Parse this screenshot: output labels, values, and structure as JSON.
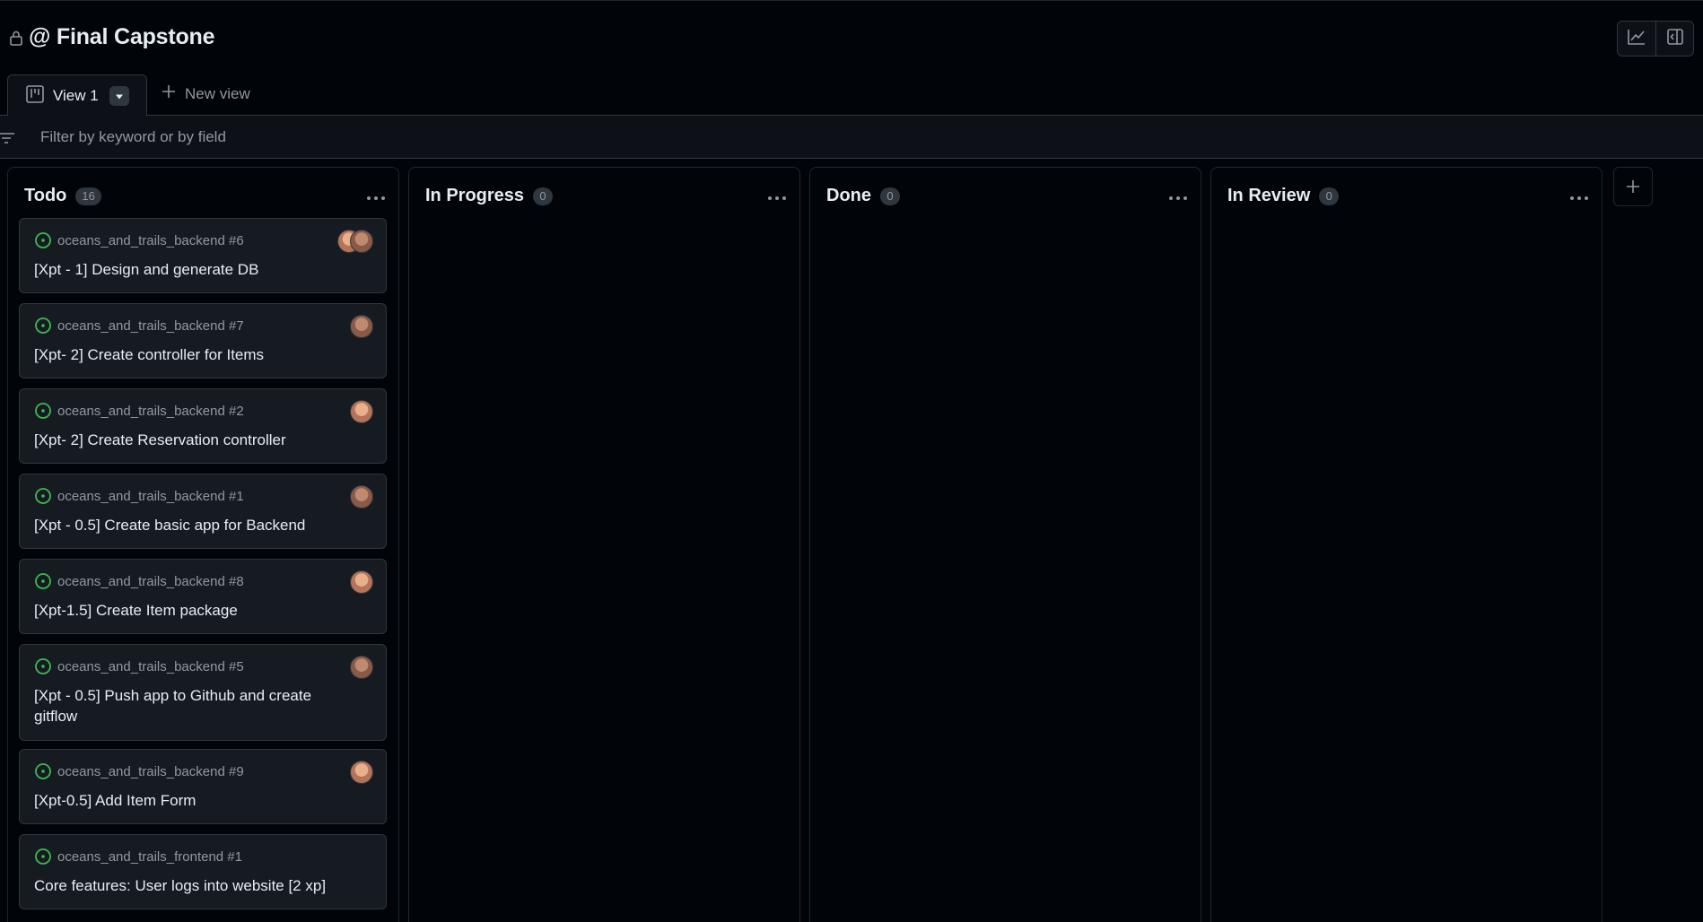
{
  "project": {
    "title": "@ Final Capstone"
  },
  "tabs": {
    "active": {
      "label": "View 1"
    },
    "new_view_label": "New view"
  },
  "filter": {
    "placeholder": "Filter by keyword or by field"
  },
  "columns": [
    {
      "title": "Todo",
      "count": "16",
      "cards": [
        {
          "repo": "oceans_and_trails_backend #6",
          "title": "[Xpt - 1] Design and generate DB",
          "avatars": 2
        },
        {
          "repo": "oceans_and_trails_backend #7",
          "title": "[Xpt- 2] Create controller for Items",
          "avatars": 1
        },
        {
          "repo": "oceans_and_trails_backend #2",
          "title": "[Xpt- 2] Create Reservation controller",
          "avatars": 1
        },
        {
          "repo": "oceans_and_trails_backend #1",
          "title": "[Xpt - 0.5] Create basic app for Backend",
          "avatars": 1
        },
        {
          "repo": "oceans_and_trails_backend #8",
          "title": "[Xpt-1.5] Create Item package",
          "avatars": 1
        },
        {
          "repo": "oceans_and_trails_backend #5",
          "title": "[Xpt - 0.5] Push app to Github and create gitflow",
          "avatars": 1
        },
        {
          "repo": "oceans_and_trails_backend #9",
          "title": "[Xpt-0.5] Add Item Form",
          "avatars": 1
        },
        {
          "repo": "oceans_and_trails_frontend #1",
          "title": "Core features: User logs into website [2 xp]",
          "avatars": 0
        }
      ]
    },
    {
      "title": "In Progress",
      "count": "0",
      "cards": []
    },
    {
      "title": "Done",
      "count": "0",
      "cards": []
    },
    {
      "title": "In Review",
      "count": "0",
      "cards": []
    }
  ],
  "colors": {
    "background": "#010409",
    "card": "#161b22",
    "border": "#30363d",
    "text": "#e6edf3",
    "muted": "#9198a1",
    "open_status": "#3fb950"
  },
  "icons": {
    "lock": "lock-icon",
    "insights": "graph-icon",
    "side_panel": "sidebar-icon",
    "board_view": "project-board-icon",
    "dropdown": "triangle-down-icon",
    "plus": "plus-icon",
    "filter": "filter-icon",
    "menu": "kebab-horizontal-icon",
    "issue_open": "issue-opened-icon"
  }
}
